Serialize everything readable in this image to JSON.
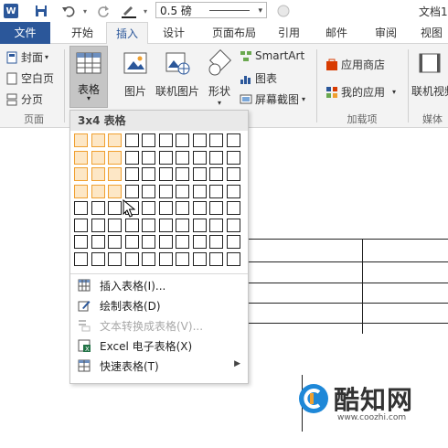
{
  "app": {
    "doc_title": "文档1",
    "font_size_value": "0.5 磅"
  },
  "tabs": {
    "file": "文件",
    "start": "开始",
    "insert": "插入",
    "design": "设计",
    "layout": "页面布局",
    "references": "引用",
    "mailings": "邮件",
    "review": "审阅",
    "view": "视图"
  },
  "ribbon": {
    "pages": {
      "cover": "封面",
      "blank": "空白页",
      "break": "分页",
      "label": "页面"
    },
    "table_button": "表格",
    "picture": "图片",
    "online_picture": "联机图片",
    "shapes": "形状",
    "smartart": "SmartArt",
    "chart": "图表",
    "screenshot": "屏幕截图",
    "app_store": "应用商店",
    "my_apps": "我的应用",
    "addins_label": "加载项",
    "online_video": "联机视频",
    "media_label": "媒体"
  },
  "menu": {
    "header": "3x4 表格",
    "grid": {
      "cols": 10,
      "rows": 8,
      "selected_cols": 3,
      "selected_rows": 4
    },
    "items": {
      "insert_table": "插入表格(I)...",
      "draw_table": "绘制表格(D)",
      "text_to_table": "文本转换成表格(V)...",
      "excel_table": "Excel 电子表格(X)",
      "quick_tables": "快速表格(T)"
    }
  },
  "watermark": {
    "brand": "酷知网",
    "url": "www.coozhi.com"
  },
  "colors": {
    "word_blue": "#2b579a",
    "grid_highlight": "#f0a030",
    "grid_fill": "#fde7c6",
    "ribbon_bg": "#f3f3f3"
  }
}
